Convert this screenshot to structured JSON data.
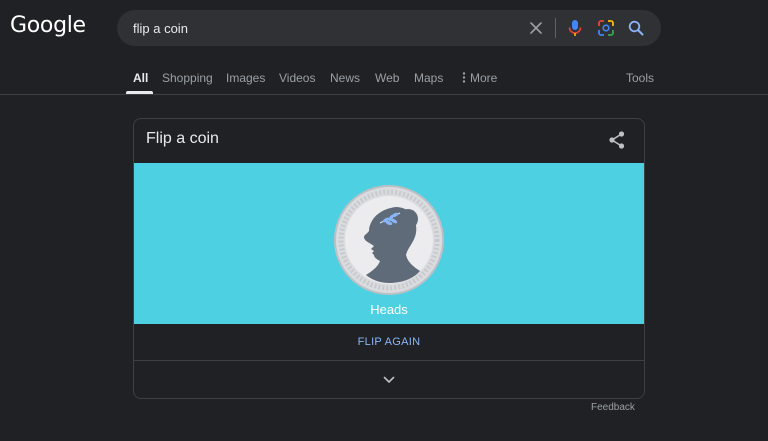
{
  "header": {
    "logo_text": "Google",
    "search": {
      "value": "flip a coin",
      "placeholder": ""
    }
  },
  "tabs": [
    {
      "label": "All",
      "active": true
    },
    {
      "label": "Shopping"
    },
    {
      "label": "Images"
    },
    {
      "label": "Videos"
    },
    {
      "label": "News"
    },
    {
      "label": "Web"
    },
    {
      "label": "Maps"
    },
    {
      "label": "More"
    },
    {
      "label": "Tools"
    }
  ],
  "card": {
    "title": "Flip a coin",
    "result": "Heads",
    "flip_label": "FLIP AGAIN"
  },
  "footer": {
    "feedback_label": "Feedback"
  },
  "colors": {
    "background": "#202124",
    "coin_area": "#4dd0e1",
    "link_blue": "#8ab4f8",
    "search_box": "#303134"
  },
  "icons": [
    "clear-icon",
    "mic-icon",
    "lens-icon",
    "search-icon",
    "share-icon",
    "more-vert-icon",
    "chevron-down-icon"
  ]
}
